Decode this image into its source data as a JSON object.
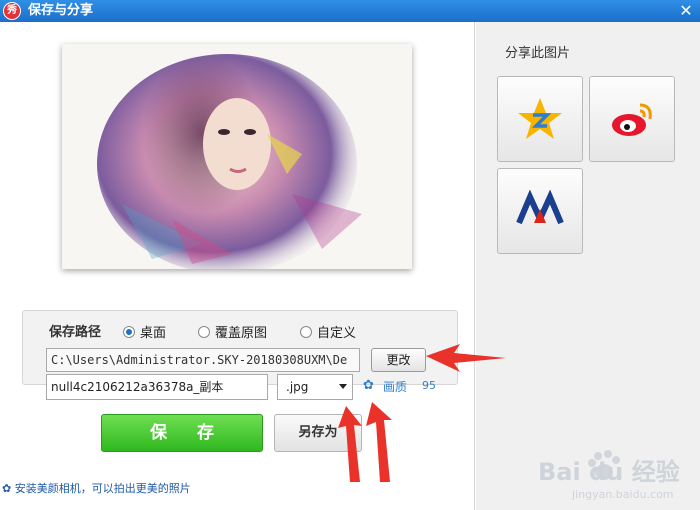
{
  "window": {
    "title": "保存与分享",
    "app_badge": "秀"
  },
  "path_group": {
    "label": "保存路径",
    "options": [
      {
        "label": "桌面",
        "selected": true
      },
      {
        "label": "覆盖原图",
        "selected": false
      },
      {
        "label": "自定义",
        "selected": false
      }
    ],
    "path_value": "C:\\Users\\Administrator.SKY-20180308UXM\\De",
    "change_label": "更改"
  },
  "file": {
    "name_value": "null4c2106212a36378a_副本",
    "ext_value": ".jpg",
    "quality_label": "画质",
    "quality_value": "95"
  },
  "buttons": {
    "save_label": "保 存",
    "saveas_label": "另存为"
  },
  "hint": "✿ 安装美颜相机，可以拍出更美的照片",
  "share": {
    "title": "分享此图片",
    "targets": [
      {
        "icon": "qzone-icon"
      },
      {
        "icon": "weibo-icon"
      },
      {
        "icon": "renren-icon"
      }
    ]
  },
  "watermark": {
    "text": "Bai du 经验",
    "sub": "jingyan.baidu.com"
  },
  "colors": {
    "title_bar": "#1d6fc9",
    "save_green": "#2fb81f",
    "link_blue": "#2f7fd1",
    "arrow_red": "#e8322a"
  }
}
